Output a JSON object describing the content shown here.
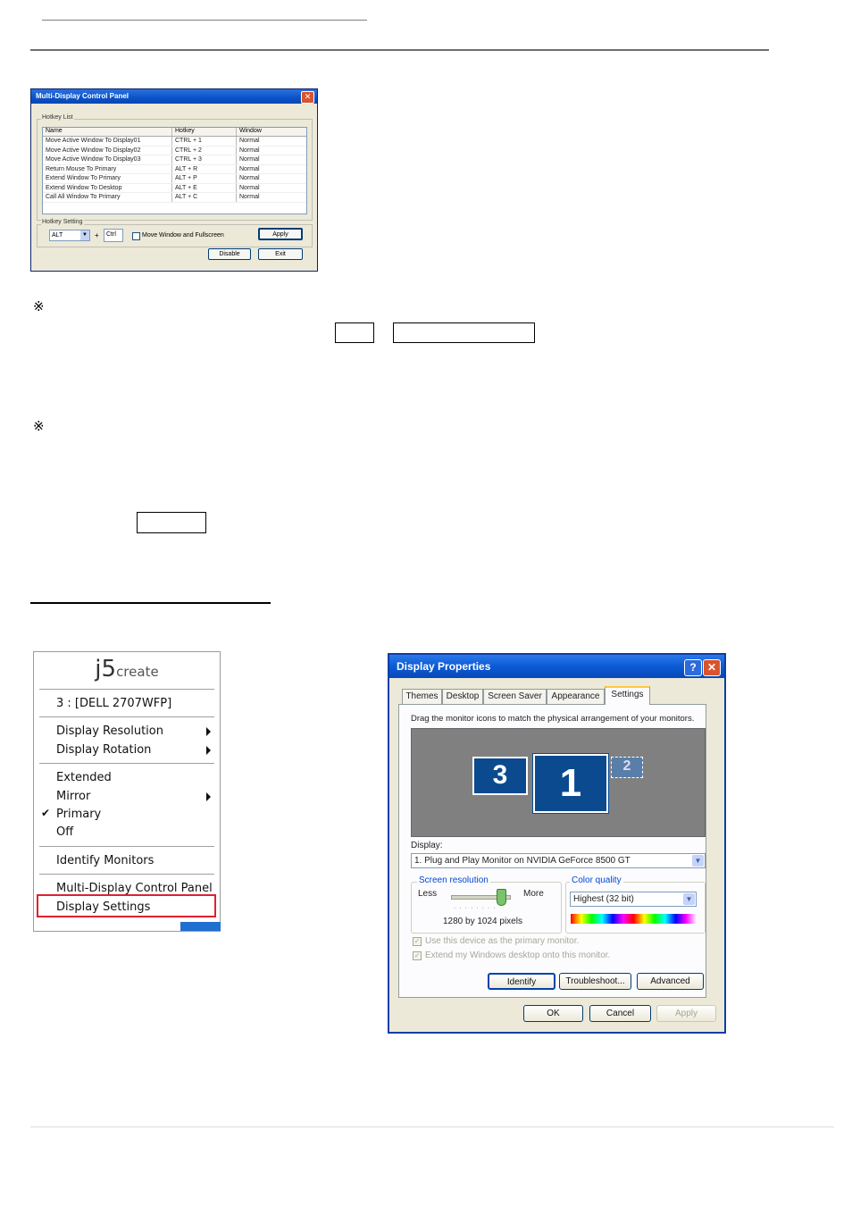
{
  "page": {
    "note_mark_1": "※",
    "note_mark_2": "※"
  },
  "mdcp": {
    "title": "Multi-Display Control Panel",
    "close_glyph": "✕",
    "hotkey_list_label": "Hotkey List",
    "columns": [
      "Name",
      "Hotkey",
      "Window"
    ],
    "rows": [
      [
        "Move Active Window To Display01",
        "CTRL + 1",
        "Normal"
      ],
      [
        "Move Active Window To Display02",
        "CTRL + 2",
        "Normal"
      ],
      [
        "Move Active Window To Display03",
        "CTRL + 3",
        "Normal"
      ],
      [
        "Return Mouse To Primary",
        "ALT + R",
        "Normal"
      ],
      [
        "Extend Window To Primary",
        "ALT + P",
        "Normal"
      ],
      [
        "Extend Window To Desktop",
        "ALT + E",
        "Normal"
      ],
      [
        "Call All Window To Primary",
        "ALT + C",
        "Normal"
      ]
    ],
    "hotkey_setting_label": "Hotkey Setting",
    "modifier_value": "ALT",
    "plus": "+",
    "key_value": "Ctrl",
    "checkbox_label": "Move Window and Fullscreen",
    "apply_label": "Apply",
    "disable_label": "Disable",
    "exit_label": "Exit"
  },
  "tray": {
    "logo_main": "j5",
    "logo_sub": "create",
    "monitor_label": "3 : [DELL 2707WFP]",
    "items": {
      "display_resolution": "Display Resolution",
      "display_rotation": "Display Rotation",
      "extended": "Extended",
      "mirror": "Mirror",
      "primary": "Primary",
      "off": "Off",
      "identify": "Identify Monitors",
      "control_panel": "Multi-Display Control Panel",
      "display_settings": "Display Settings"
    },
    "check_glyph": "✔"
  },
  "dp": {
    "title": "Display Properties",
    "help_glyph": "?",
    "close_glyph": "✕",
    "tabs": [
      "Themes",
      "Desktop",
      "Screen Saver",
      "Appearance",
      "Settings"
    ],
    "instruction": "Drag the monitor icons to match the physical arrangement of your monitors.",
    "monitors": [
      "3",
      "1",
      "2"
    ],
    "display_label": "Display:",
    "display_value": "1. Plug and Play Monitor on NVIDIA GeForce 8500 GT",
    "resolution_label": "Screen resolution",
    "less": "Less",
    "more": "More",
    "resolution_value": "1280 by 1024 pixels",
    "resolution_slider_fraction": 0.85,
    "color_label": "Color quality",
    "color_value": "Highest (32 bit)",
    "primary_checkbox": "Use this device as the primary monitor.",
    "extend_checkbox": "Extend my Windows desktop onto this monitor.",
    "identify": "Identify",
    "troubleshoot": "Troubleshoot...",
    "advanced": "Advanced",
    "ok": "OK",
    "cancel": "Cancel",
    "apply": "Apply"
  }
}
